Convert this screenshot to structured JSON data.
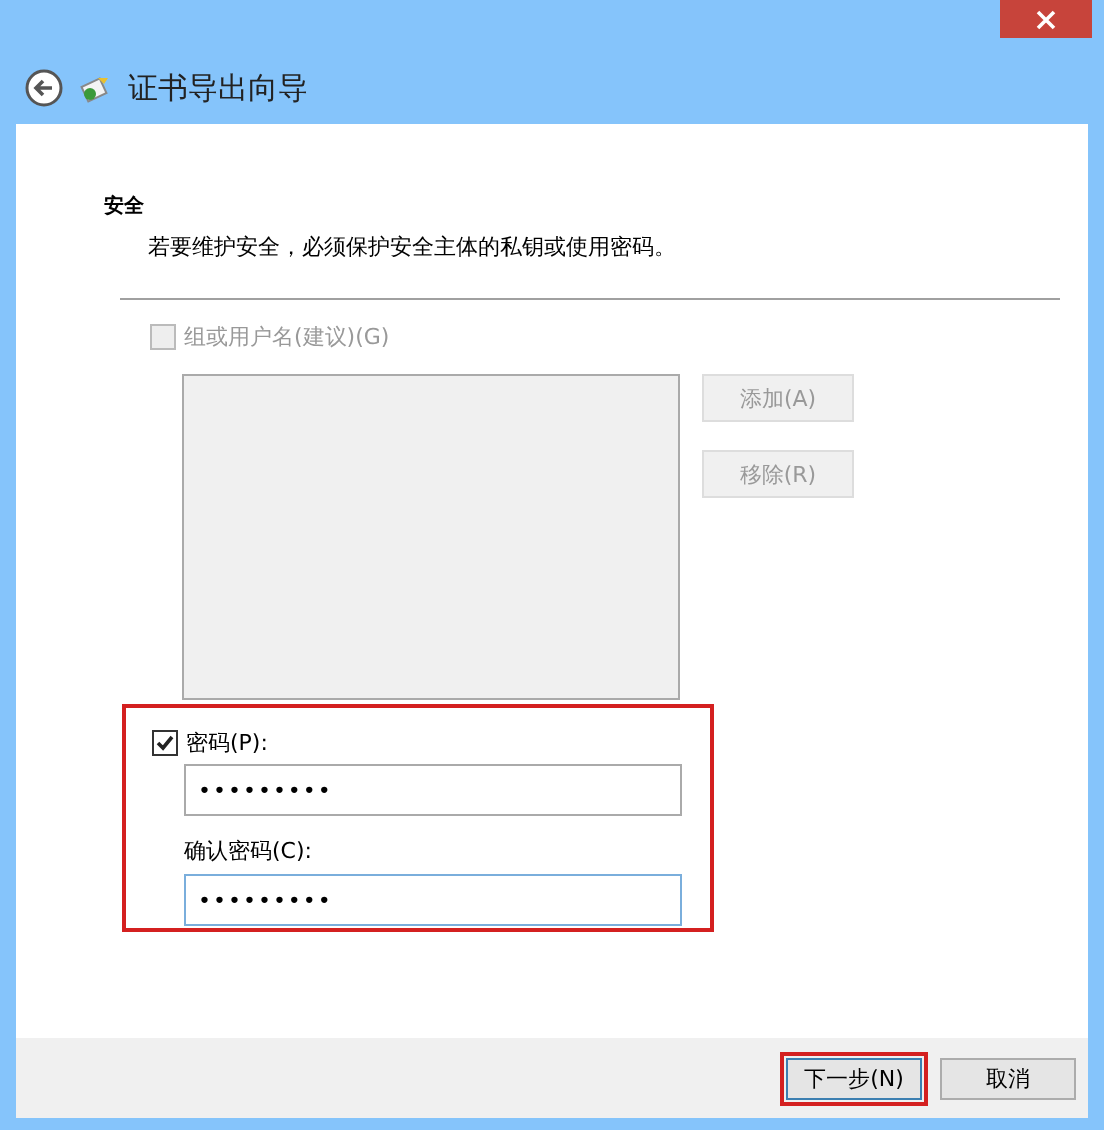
{
  "window": {
    "title": "证书导出向导"
  },
  "section": {
    "heading": "安全",
    "description": "若要维护安全，必须保护安全主体的私钥或使用密码。"
  },
  "group_option": {
    "label": "组或用户名(建议)(G)",
    "checked": false,
    "disabled": true
  },
  "side_buttons": [
    {
      "label": "添加(A)",
      "disabled": true
    },
    {
      "label": "移除(R)",
      "disabled": true
    }
  ],
  "password_option": {
    "label": "密码(P):",
    "checked": true,
    "disabled": false
  },
  "password_field": {
    "value": "•••••••••",
    "focused": false
  },
  "confirm_label": "确认密码(C):",
  "confirm_field": {
    "value": "•••••••••",
    "focused": true
  },
  "buttons": [
    {
      "label": "下一步(N)",
      "highlighted": true
    },
    {
      "label": "取消",
      "highlighted": false
    }
  ]
}
